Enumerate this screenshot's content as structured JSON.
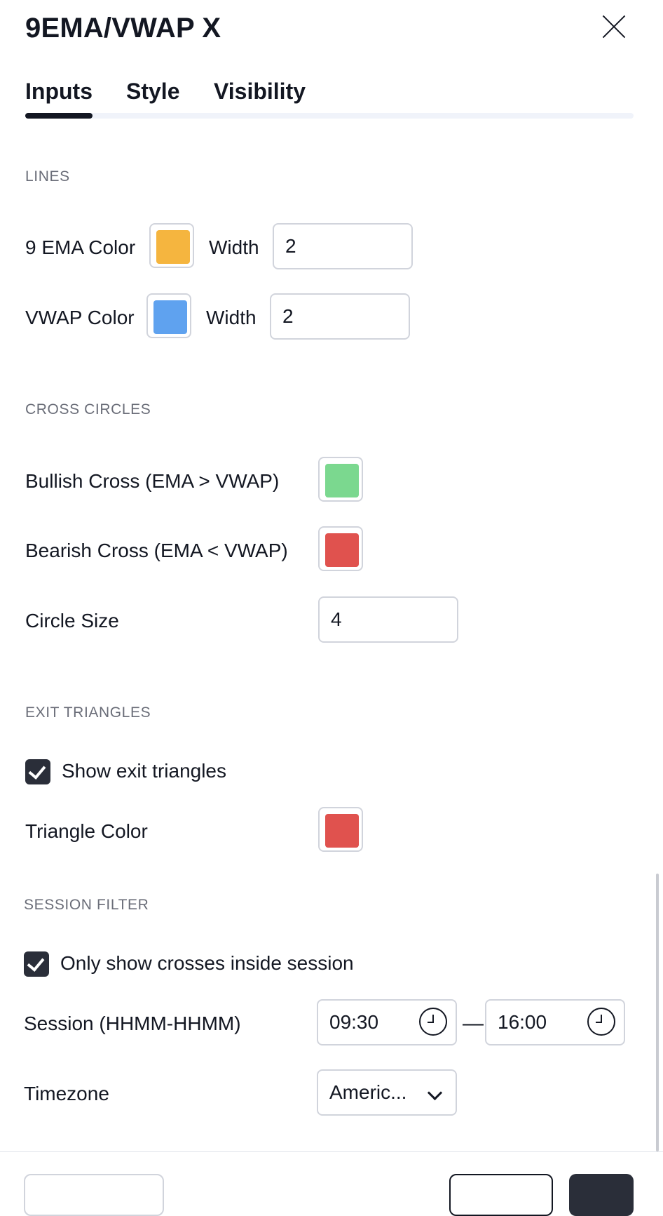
{
  "dialog": {
    "title": "9EMA/VWAP X"
  },
  "tabs": [
    {
      "label": "Inputs",
      "active": true
    },
    {
      "label": "Style",
      "active": false
    },
    {
      "label": "Visibility",
      "active": false
    }
  ],
  "lines": {
    "section_title": "LINES",
    "ema": {
      "label": "9 EMA Color",
      "color": "#F5B53F",
      "width_label": "Width",
      "width_value": "2"
    },
    "vwap": {
      "label": "VWAP Color",
      "color": "#5FA2EF",
      "width_label": "Width",
      "width_value": "2"
    }
  },
  "cross_circles": {
    "section_title": "CROSS CIRCLES",
    "bullish": {
      "label": "Bullish Cross (EMA > VWAP)",
      "color": "#7BD88F"
    },
    "bearish": {
      "label": "Bearish Cross (EMA < VWAP)",
      "color": "#E0524E"
    },
    "circle_size": {
      "label": "Circle Size",
      "value": "4"
    }
  },
  "exit_triangles": {
    "section_title": "EXIT TRIANGLES",
    "show": {
      "label": "Show exit triangles",
      "checked": true
    },
    "triangle_color": {
      "label": "Triangle Color",
      "color": "#E0524E"
    }
  },
  "session_filter": {
    "section_title": "SESSION FILTER",
    "only_inside": {
      "label": "Only show crosses inside session",
      "checked": true
    },
    "session": {
      "label": "Session (HHMM-HHMM)",
      "start": "09:30",
      "separator": "—",
      "end": "16:00"
    },
    "timezone": {
      "label": "Timezone",
      "value": "Americ..."
    }
  },
  "icons": {
    "close": "close-icon",
    "clock": "clock-icon",
    "chevron": "chevron-down-icon",
    "check": "check-icon"
  }
}
